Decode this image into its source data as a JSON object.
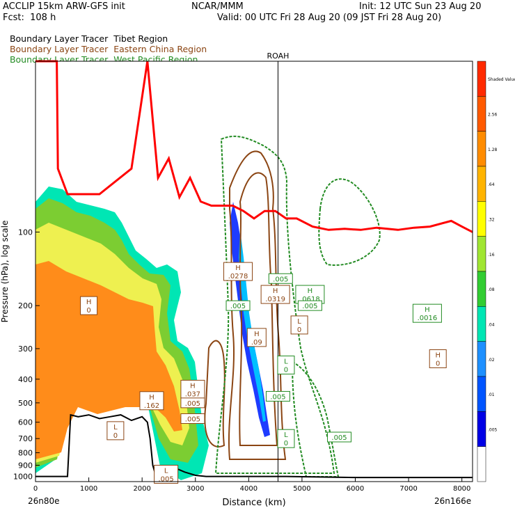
{
  "header": {
    "model": "ACCLIP 15km ARW-GFS init",
    "org": "NCAR/MMM",
    "init": "Init: 12 UTC Sun 23 Aug 20",
    "fcst": "Fcst:  108 h",
    "valid": "Valid: 00 UTC Fri 28 Aug 20 (09 JST Fri 28 Aug 20)",
    "legend": [
      {
        "prefix": "Boundary Layer Tracer",
        "region": "Tibet Region",
        "color": "#000000"
      },
      {
        "prefix": "Boundary Layer Tracer",
        "region": "Eastern China Region",
        "color": "#8b4513"
      },
      {
        "prefix": "Boundary Layer Tracer",
        "region": "West Pacific Region",
        "color": "#228b22"
      }
    ]
  },
  "chart_data": {
    "type": "cross-section",
    "xlabel": "Distance (km)",
    "ylabel": "Pressure (hPa), log scale",
    "xlim": [
      0,
      8200
    ],
    "ylim": [
      1050,
      20
    ],
    "x_ticks": [
      "0",
      "1000",
      "2000",
      "3000",
      "4000",
      "5000",
      "6000",
      "7000",
      "8000"
    ],
    "y_ticks": [
      "100",
      "200",
      "300",
      "400",
      "500",
      "600",
      "700",
      "800",
      "900",
      "1000"
    ],
    "left_endpoint": "26n80e",
    "right_endpoint": "26n166e",
    "station": {
      "label": "ROAH",
      "x": 4550
    },
    "colorbar": {
      "levels": [
        "Shaded Value",
        "2.56",
        "1.28",
        ".64",
        ".32",
        ".16",
        ".08",
        ".04",
        ".02",
        ".01",
        ".005"
      ],
      "colors": [
        "#ff2a00",
        "#ff5a00",
        "#ff8c00",
        "#ffb400",
        "#ffff00",
        "#a0e632",
        "#32cd32",
        "#00e6b4",
        "#1e90ff",
        "#0055ff",
        "#0000e6",
        "#ffffff"
      ]
    },
    "tropopause_color": "#ff0000",
    "terrain_color": "#000000",
    "labels_tibet": [
      {
        "text": "H",
        "value": "0",
        "x": 1000,
        "p": 200
      },
      {
        "text": "L",
        "value": "0",
        "x": 1500,
        "p": 650
      },
      {
        "text": "H",
        "value": ".162",
        "x": 2180,
        "p": 490
      },
      {
        "text": "L",
        "value": ".005",
        "x": 2450,
        "p": 980
      }
    ],
    "labels_china": [
      {
        "text": "H",
        "value": ".037",
        "x": 2950,
        "p": 440
      },
      {
        "text": "",
        "value": ".005",
        "x": 2950,
        "p": 500
      },
      {
        "text": "",
        "value": ".005",
        "x": 2950,
        "p": 580
      },
      {
        "text": "H",
        "value": ".0278",
        "x": 3800,
        "p": 145
      },
      {
        "text": "H",
        "value": ".0319",
        "x": 4500,
        "p": 180
      },
      {
        "text": "H",
        "value": ".09",
        "x": 4150,
        "p": 270
      },
      {
        "text": "L",
        "value": "0",
        "x": 4950,
        "p": 240
      },
      {
        "text": "H",
        "value": "0",
        "x": 7550,
        "p": 330
      }
    ],
    "labels_pacific": [
      {
        "text": "",
        "value": ".005",
        "x": 4600,
        "p": 155
      },
      {
        "text": "H",
        "value": ".0618",
        "x": 5150,
        "p": 180
      },
      {
        "text": "",
        "value": ".005",
        "x": 5150,
        "p": 200
      },
      {
        "text": "H",
        "value": ".0016",
        "x": 7350,
        "p": 215
      },
      {
        "text": "L",
        "value": "0",
        "x": 4700,
        "p": 350
      },
      {
        "text": "",
        "value": ".005",
        "x": 4550,
        "p": 470
      },
      {
        "text": "L",
        "value": "0",
        "x": 4700,
        "p": 700
      },
      {
        "text": "",
        "value": ".005",
        "x": 5700,
        "p": 690
      },
      {
        "text": "",
        "value": ".005",
        "x": 3800,
        "p": 200
      }
    ]
  }
}
